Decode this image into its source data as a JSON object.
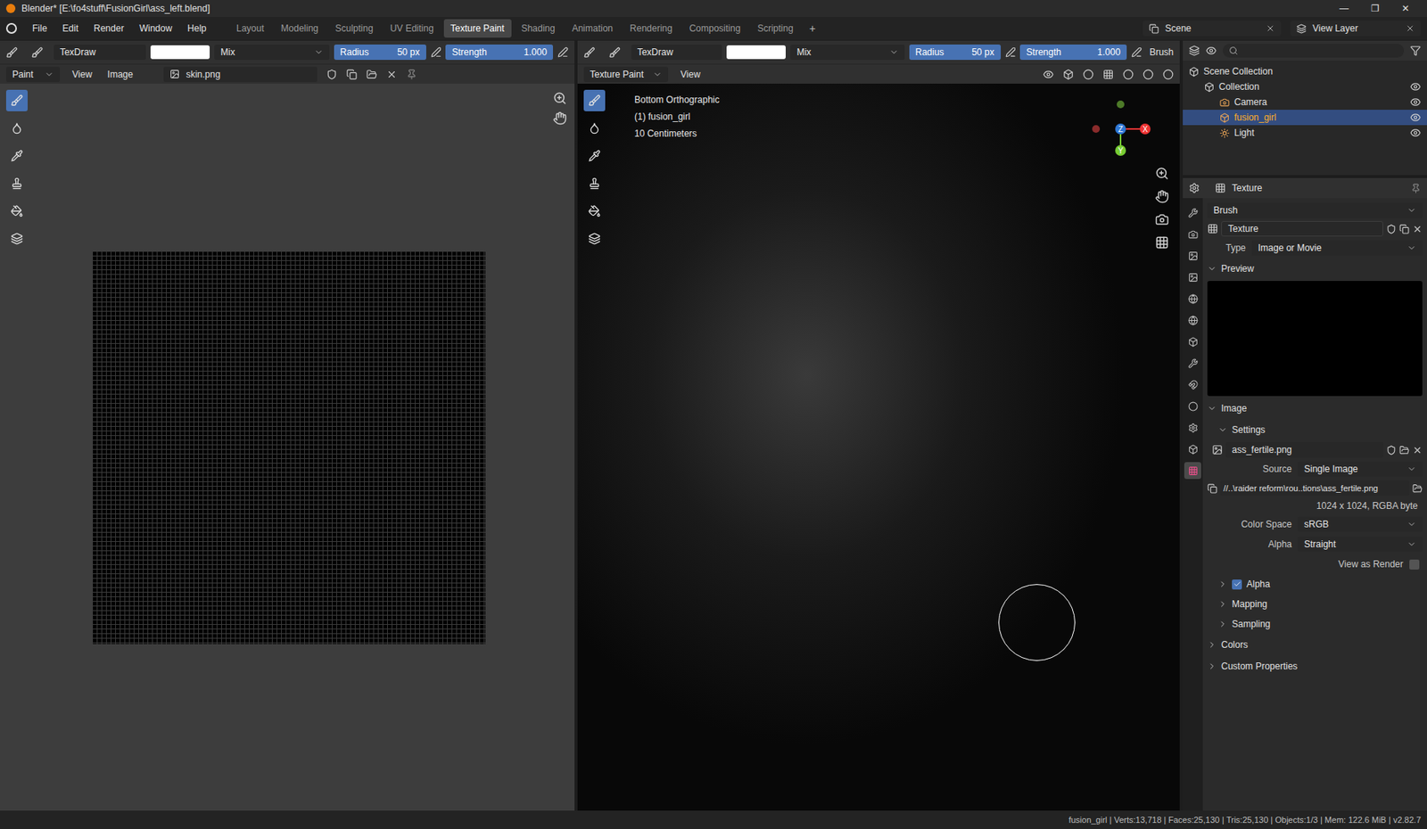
{
  "window": {
    "title": "Blender* [E:\\fo4stuff\\FusionGirl\\ass_left.blend]",
    "controls": [
      "—",
      "❐",
      "✕"
    ]
  },
  "menu": [
    "File",
    "Edit",
    "Render",
    "Window",
    "Help"
  ],
  "workspaces": [
    {
      "label": "Layout",
      "selected": false
    },
    {
      "label": "Modeling",
      "selected": false
    },
    {
      "label": "Sculpting",
      "selected": false
    },
    {
      "label": "UV Editing",
      "selected": false
    },
    {
      "label": "Texture Paint",
      "selected": true
    },
    {
      "label": "Shading",
      "selected": false
    },
    {
      "label": "Animation",
      "selected": false
    },
    {
      "label": "Rendering",
      "selected": false
    },
    {
      "label": "Compositing",
      "selected": false
    },
    {
      "label": "Scripting",
      "selected": false
    }
  ],
  "addWorkspace": "+",
  "scene": "Scene",
  "viewLayer": "View Layer",
  "imageEditor": {
    "brush": "TexDraw",
    "blend": "Mix",
    "radiusLabel": "Radius",
    "radius": "50 px",
    "radiusLevel": 1,
    "strengthLabel": "Strength",
    "strength": "1.000",
    "strengthLevel": 1,
    "mode": "Paint",
    "menus": [
      "View",
      "Image"
    ],
    "image": "skin.png"
  },
  "viewport": {
    "brush": "TexDraw",
    "blend": "Mix",
    "radiusLabel": "Radius",
    "radius": "50 px",
    "radiusLevel": 1,
    "strengthLabel": "Strength",
    "strength": "1.000",
    "strengthLevel": 1,
    "brushMenu": "Brush",
    "mode": "Texture Paint",
    "menus": [
      "View"
    ],
    "overlay": [
      "Bottom Orthographic",
      "(1) fusion_girl",
      "10 Centimeters"
    ],
    "axes": {
      "x": "X",
      "y": "Y",
      "z": "Z"
    }
  },
  "outliner": {
    "items": [
      {
        "label": "Scene Collection",
        "depth": 0,
        "selected": false,
        "kind": "scene"
      },
      {
        "label": "Collection",
        "depth": 1,
        "selected": false,
        "kind": "collection"
      },
      {
        "label": "Camera",
        "depth": 2,
        "selected": false,
        "kind": "camera"
      },
      {
        "label": "fusion_girl",
        "depth": 2,
        "selected": true,
        "kind": "mesh"
      },
      {
        "label": "Light",
        "depth": 2,
        "selected": false,
        "kind": "light"
      }
    ]
  },
  "properties": {
    "tabs": [
      {
        "selected": false
      },
      {
        "selected": false
      },
      {
        "selected": false
      },
      {
        "selected": false
      },
      {
        "selected": false
      },
      {
        "selected": false
      },
      {
        "selected": false
      },
      {
        "selected": false
      },
      {
        "selected": false
      },
      {
        "selected": false
      },
      {
        "selected": false
      },
      {
        "selected": false
      },
      {
        "selected": true
      }
    ],
    "header": "Texture",
    "context": "Brush",
    "textureName": "Texture",
    "typeLabel": "Type",
    "type": "Image or Movie",
    "preview": {
      "label": "Preview",
      "expanded": true
    },
    "image": {
      "label": "Image",
      "expanded": true
    },
    "settings": {
      "label": "Settings",
      "expanded": true
    },
    "file": "ass_fertile.png",
    "sourceLabel": "Source",
    "source": "Single Image",
    "path": "//..\\raider reform\\rou..tions\\ass_fertile.png",
    "info": "1024 x 1024,  RGBA byte",
    "colorSpaceLabel": "Color Space",
    "colorSpace": "sRGB",
    "alphaLabel": "Alpha",
    "alpha": "Straight",
    "viewAsRender": {
      "label": "View as Render",
      "checked": false
    },
    "subpanels": [
      {
        "label": "Alpha",
        "kind": "checkbox",
        "checked": true
      },
      {
        "label": "Mapping",
        "kind": "plain",
        "checked": false
      },
      {
        "label": "Sampling",
        "kind": "plain",
        "checked": false
      }
    ],
    "closedSections": [
      "Colors",
      "Custom Properties"
    ]
  },
  "statusBar": "fusion_girl | Verts:13,718 | Faces:25,130 | Tris:25,130 | Objects:1/3 | Mem: 122.6 MiB | v2.82.7"
}
